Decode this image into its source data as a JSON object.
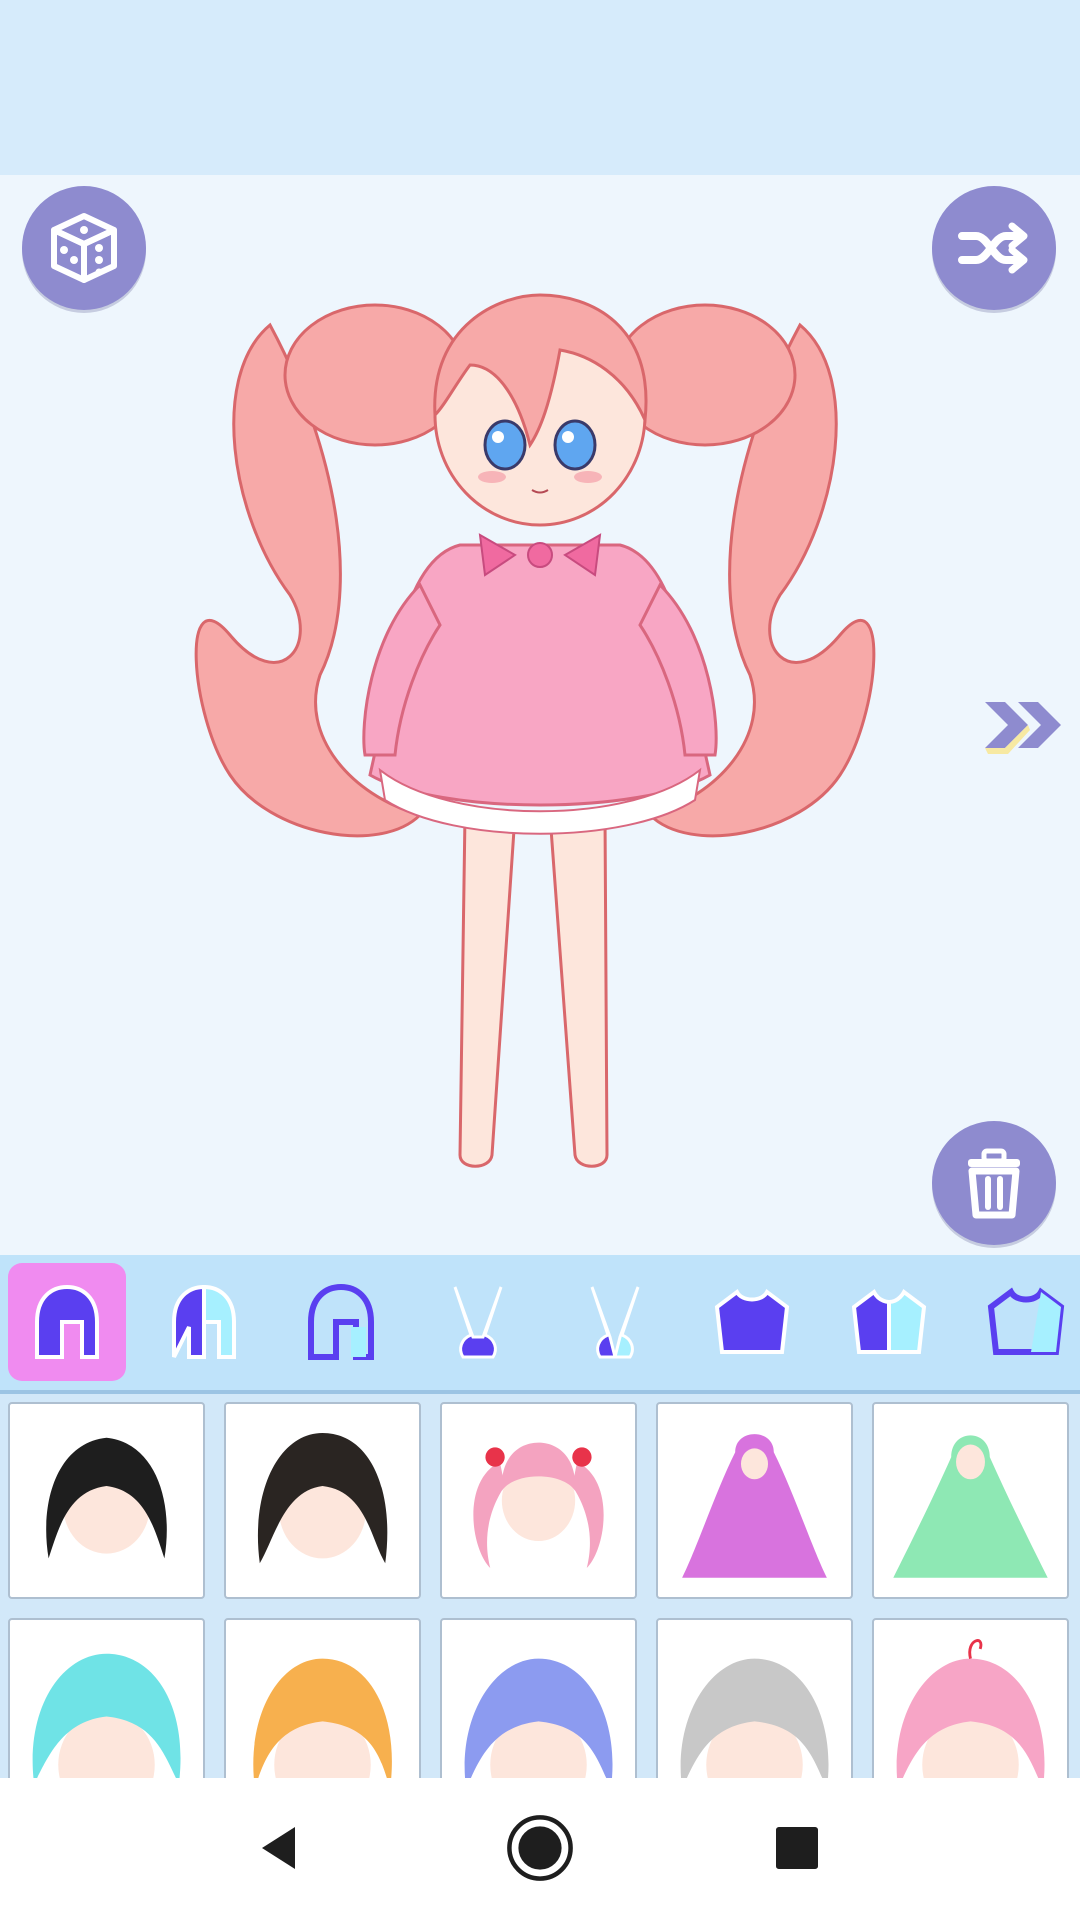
{
  "app": {
    "colors": {
      "topbar": "#d6ebfb",
      "stage": "#eef6fd",
      "button": "#8e8bcf",
      "category_bar": "#bfe3fa",
      "category_active": "#f08bf0",
      "category_icon": "#5a3ff0",
      "category_icon_alt": "#a6f0ff",
      "grid_bg": "#d2e8f9"
    },
    "buttons": {
      "random_icon": "dice-icon",
      "shuffle_icon": "shuffle-icon",
      "delete_icon": "trash-icon",
      "next_icon": "double-chevron-right-icon"
    },
    "categories": [
      {
        "icon": "hair-front-icon",
        "active": true
      },
      {
        "icon": "hair-front-alt-icon",
        "active": false
      },
      {
        "icon": "hair-back-outline-icon",
        "active": false
      },
      {
        "icon": "bunny-ears-icon",
        "active": false
      },
      {
        "icon": "bunny-ears-alt-icon",
        "active": false
      },
      {
        "icon": "top-shirt-icon",
        "active": false
      },
      {
        "icon": "top-shirt-alt-icon",
        "active": false
      },
      {
        "icon": "top-shirt-outline-icon",
        "active": false
      }
    ],
    "items": [
      {
        "name": "hair-black-short",
        "color": "#1e1e1e"
      },
      {
        "name": "hair-black-bob",
        "color": "#2a2522"
      },
      {
        "name": "hair-pink-twintails",
        "color": "#f4a3c0"
      },
      {
        "name": "hair-purple-long",
        "color": "#d873de"
      },
      {
        "name": "hair-mint-long",
        "color": "#8ee8b4"
      },
      {
        "name": "hair-cyan-spiky",
        "color": "#6fe3e6"
      },
      {
        "name": "hair-orange-short",
        "color": "#f7b04e"
      },
      {
        "name": "hair-blue-short",
        "color": "#8c9bf0"
      },
      {
        "name": "hair-gray-short",
        "color": "#c8c8c8"
      },
      {
        "name": "hair-pink-bob",
        "color": "#f7a5c6"
      }
    ],
    "navbar": {
      "back_icon": "back-triangle-icon",
      "home_icon": "home-circle-icon",
      "recents_icon": "recents-square-icon"
    }
  }
}
